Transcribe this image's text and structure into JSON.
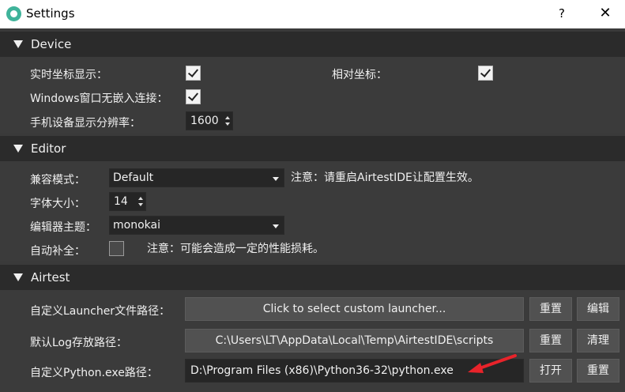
{
  "window": {
    "title": "Settings",
    "help": "?",
    "close": "✕"
  },
  "device": {
    "header": "Device",
    "realtime_coords_label": "实时坐标显示：",
    "realtime_coords_checked": true,
    "relative_coords_label": "相对坐标：",
    "relative_coords_checked": true,
    "windows_embed_label": "Windows窗口无嵌入连接：",
    "windows_embed_checked": true,
    "resolution_label": "手机设备显示分辨率：",
    "resolution_value": "1600"
  },
  "editor": {
    "header": "Editor",
    "compat_label": "兼容模式：",
    "compat_value": "Default",
    "compat_note": "注意：请重启AirtestIDE让配置生效。",
    "font_size_label": "字体大小：",
    "font_size_value": "14",
    "theme_label": "编辑器主题：",
    "theme_value": "monokai",
    "autocomplete_label": "自动补全：",
    "autocomplete_checked": false,
    "autocomplete_note": "注意：可能会造成一定的性能损耗。"
  },
  "airtest": {
    "header": "Airtest",
    "launcher_label": "自定义Launcher文件路径：",
    "launcher_button": "Click to select custom launcher...",
    "launcher_reset": "重置",
    "launcher_edit": "编辑",
    "log_label": "默认Log存放路径：",
    "log_path": "C:\\Users\\LT\\AppData\\Local\\Temp\\AirtestIDE\\scripts",
    "log_reset": "重置",
    "log_clear": "清理",
    "python_label": "自定义Python.exe路径：",
    "python_path": "D:\\Program Files (x86)\\Python36-32\\python.exe",
    "python_open": "打开",
    "python_reset": "重置"
  },
  "colors": {
    "annotation_arrow": "#e8232a",
    "header_bg": "#2b2b2b",
    "body_bg": "#3b3b3b"
  }
}
